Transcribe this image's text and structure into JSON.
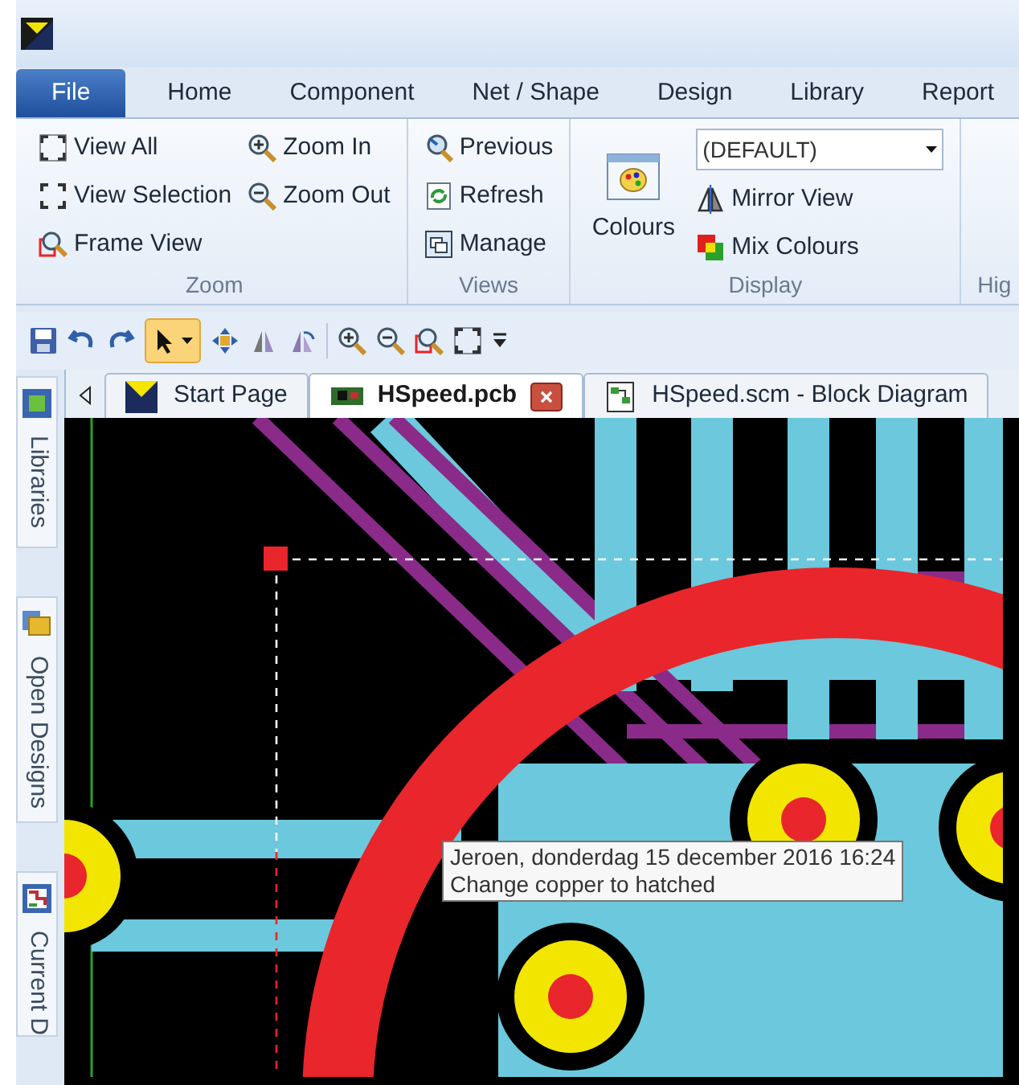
{
  "ribbon_tabs": [
    {
      "label": "File",
      "selected": true
    },
    {
      "label": "Home",
      "selected": false
    },
    {
      "label": "Component",
      "selected": false
    },
    {
      "label": "Net / Shape",
      "selected": false
    },
    {
      "label": "Design",
      "selected": false
    },
    {
      "label": "Library",
      "selected": false
    },
    {
      "label": "Report",
      "selected": false
    }
  ],
  "ribbon_groups": [
    {
      "label": "Zoom",
      "columns": [
        [
          "View All",
          "View Selection",
          "Frame View"
        ],
        [
          "Zoom In",
          "Zoom Out"
        ]
      ]
    },
    {
      "label": "Views",
      "columns": [
        [
          "Previous",
          "Refresh",
          "Manage"
        ]
      ]
    },
    {
      "label": "Display",
      "colours_button": "Colours",
      "dropdown": {
        "value": "(DEFAULT)"
      },
      "columns": [
        [
          "Mirror View",
          "Mix Colours"
        ]
      ]
    },
    {
      "label": "Hig"
    }
  ],
  "toolbar": {
    "select_tool_active": true
  },
  "doc_tabs": [
    {
      "label": "Start Page",
      "selected": false
    },
    {
      "label": "HSpeed.pcb",
      "selected": true
    },
    {
      "label": "HSpeed.scm - Block Diagram",
      "selected": false
    }
  ],
  "side_panels": [
    {
      "label": "Libraries"
    },
    {
      "label": "Open Designs"
    },
    {
      "label": "Current D"
    }
  ],
  "tooltip": {
    "lines": [
      "Jeroen, donderdag 15 december 2016 16:24",
      "Change copper to hatched"
    ]
  }
}
